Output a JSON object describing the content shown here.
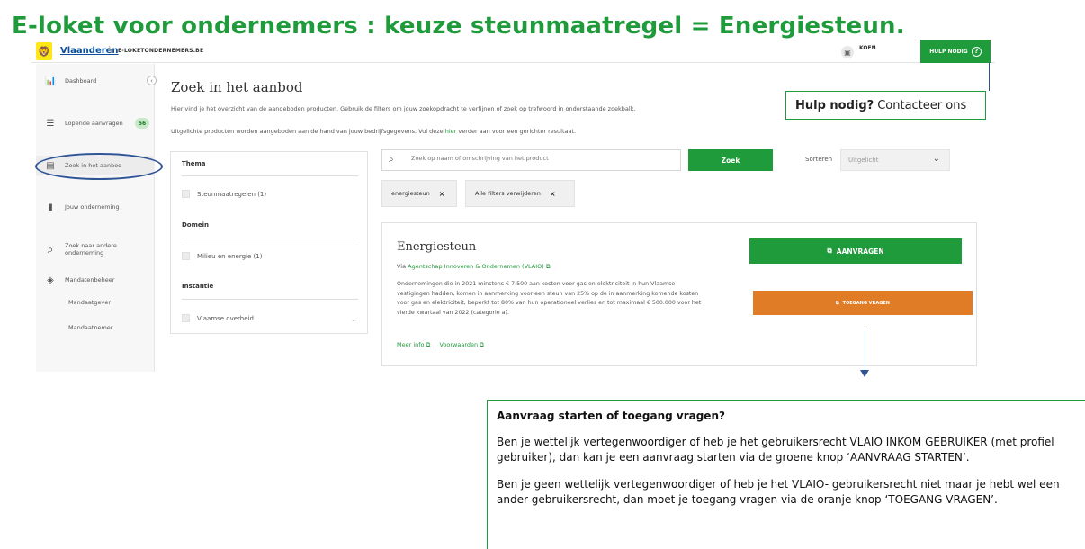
{
  "slide_title": "E-loket voor ondernemers : keuze steunmaatregel = Energiesteun.",
  "topbar": {
    "brand": "Vlaanderen",
    "brand_sub": "E-LOKETONDERNEMERS.BE",
    "user_name": "KOEN",
    "help_label": "HULP NODIG",
    "help_icon": "question-circle-icon"
  },
  "sidebar": {
    "items": [
      {
        "label": "Dashboard",
        "icon": "chart-icon"
      },
      {
        "label": "Lopende aanvragen",
        "icon": "list-icon",
        "badge": "56"
      },
      {
        "label": "Zoek in het aanbod",
        "icon": "document-icon"
      },
      {
        "label": "Jouw onderneming",
        "icon": "building-icon"
      },
      {
        "label": "Zoek naar andere onderneming",
        "icon": "search-icon"
      },
      {
        "label": "Mandatenbeheer",
        "icon": "layers-icon"
      },
      {
        "label": "Mandaatgever"
      },
      {
        "label": "Mandaatnemer"
      }
    ]
  },
  "main": {
    "title": "Zoek in het aanbod",
    "intro1": "Hier vind je het overzicht van de aangeboden producten. Gebruik de filters om jouw zoekopdracht te verfijnen of zoek op trefwoord in onderstaande zoekbalk.",
    "intro2_pre": "Uitgelichte producten worden aangeboden aan de hand van jouw bedrijfsgegevens. Vul deze ",
    "intro2_link": "hier",
    "intro2_post": " verder aan voor een gerichter resultaat."
  },
  "filters": {
    "thema": {
      "heading": "Thema",
      "option": "Steunmaatregelen (1)"
    },
    "domein": {
      "heading": "Domein",
      "option": "Milieu en energie (1)"
    },
    "instantie": {
      "heading": "Instantie",
      "option": "Vlaamse overheid"
    }
  },
  "search": {
    "placeholder": "Zoek op naam of omschrijving van het product",
    "button": "Zoek",
    "sort_label": "Sorteren",
    "sort_value": "Uitgelicht"
  },
  "chips": [
    {
      "label": "energiesteun"
    },
    {
      "label": "Alle filters verwijderen"
    }
  ],
  "result": {
    "title": "Energiesteun",
    "via_pre": "Via ",
    "via_link": "Agentschap Innoveren & Ondernemen (VLAIO)",
    "description": "Ondernemingen die in 2021 minstens € 7.500 aan kosten voor gas en elektriciteit in hun Vlaamse vestigingen hadden, komen in aanmerking voor een steun van 25% op de in aanmerking komende kosten voor gas en elektriciteit, beperkt tot 80% van hun operationeel verlies en tot maximaal € 500.000 voor het vierde kwartaal van 2022 (categorie a).",
    "meer_info": "Meer info",
    "voorwaarden": "Voorwaarden",
    "btn_aanvragen": "AANVRAGEN",
    "btn_toegang": "TOEGANG VRAGEN"
  },
  "callout_help": {
    "bold": "Hulp nodig?",
    "rest": "Contacteer ons"
  },
  "info_box": {
    "heading": "Aanvraag starten of toegang vragen?",
    "p1": "Ben je wettelijk vertegenwoordiger of heb je het gebruikersrecht VLAIO INKOM GEBRUIKER (met profiel gebruiker), dan kan je een aanvraag starten via de groene knop ‘AANVRAAG STARTEN’.",
    "p2": "Ben je geen wettelijk vertegenwoordiger of heb je het VLAIO- gebruikersrecht niet maar je hebt wel een ander gebruikersrecht, dan moet je toegang vragen via de oranje knop ‘TOEGANG VRAGEN’."
  },
  "colors": {
    "green": "#1f9b3b",
    "orange": "#e07c26",
    "annotation_blue": "#2f5496",
    "vlaanderen_yellow": "#ffe615"
  }
}
